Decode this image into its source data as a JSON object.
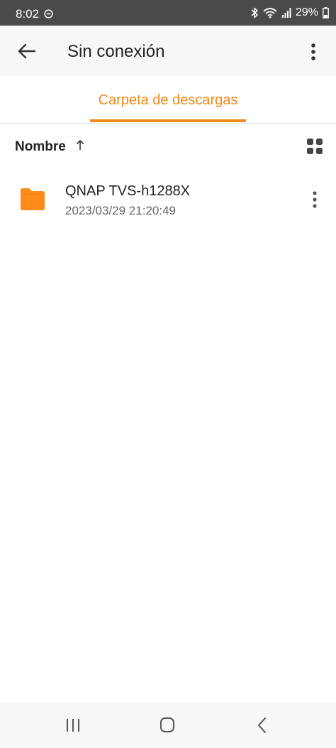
{
  "status_bar": {
    "time": "8:02",
    "battery": "29%",
    "icons": [
      "do-not-disturb-icon",
      "bluetooth-icon",
      "wifi-icon",
      "signal-icon",
      "battery-icon"
    ]
  },
  "app_bar": {
    "title": "Sin conexión",
    "back_icon": "arrow-left-icon",
    "menu_icon": "more-vertical-icon"
  },
  "tabs": [
    {
      "label": "Carpeta de descargas",
      "active": true
    }
  ],
  "sort": {
    "label": "Nombre",
    "direction_icon": "arrow-up-icon",
    "view_toggle_icon": "grid-view-icon"
  },
  "files": [
    {
      "name": "QNAP TVS-h1288X",
      "date": "2023/03/29 21:20:49",
      "icon": "folder-icon"
    }
  ],
  "nav_bar": {
    "icons": [
      "recents-icon",
      "home-icon",
      "back-icon"
    ]
  },
  "colors": {
    "accent": "#ef8a1b",
    "folder": "#ff8c1a",
    "status_bar": "#4a4a4a",
    "app_bar": "#f7f7f7"
  }
}
